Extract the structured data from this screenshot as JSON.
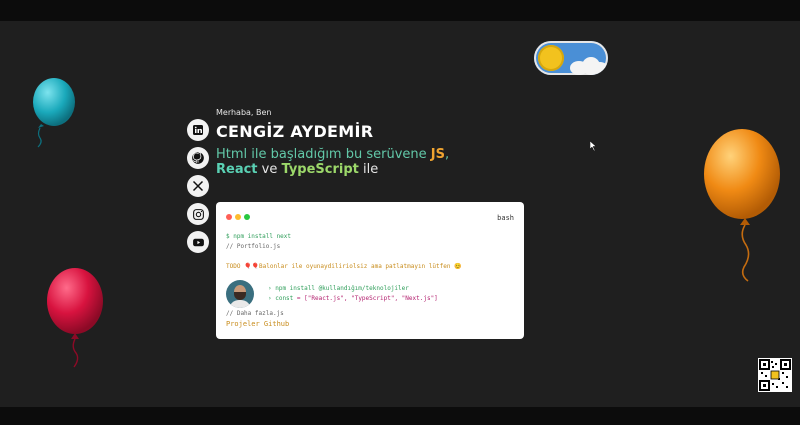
{
  "hero": {
    "greeting": "Merhaba, Ben",
    "name": "CENGİZ AYDEMİR",
    "line1_text": "Html ile başladığım bu serüvene ",
    "line1_js": "JS",
    "line1_comma": ",",
    "line2_react": "React",
    "line2_ve": " ve ",
    "line2_ts": "TypeScript",
    "line2_ile": " ile"
  },
  "social": [
    {
      "name": "linkedin-icon",
      "glyph": "in"
    },
    {
      "name": "github-icon",
      "glyph": "gh"
    },
    {
      "name": "x-icon",
      "glyph": "X"
    },
    {
      "name": "instagram-icon",
      "glyph": "ig"
    },
    {
      "name": "youtube-icon",
      "glyph": "yt"
    }
  ],
  "terminal": {
    "label": "bash",
    "cmd1": "$ npm install next",
    "comment1": "// Portfolio.js",
    "todo": "TODO 🎈🎈Balonlar ile oyunaydiliriolsiz ama patlatmayın lütfen 😊",
    "cmd2": "› npm install @kullandığım/teknolojiler",
    "const_kw": "› const",
    "const_rest": " = [\"React.js\", \"TypeScript\", \"Next.js\"]",
    "comment2": "// Daha fazla.js",
    "link": "Projeler Github"
  },
  "colors": {
    "background": "#1f1f1f",
    "accent_teal": "#62c8a8",
    "accent_orange": "#f0a430"
  }
}
